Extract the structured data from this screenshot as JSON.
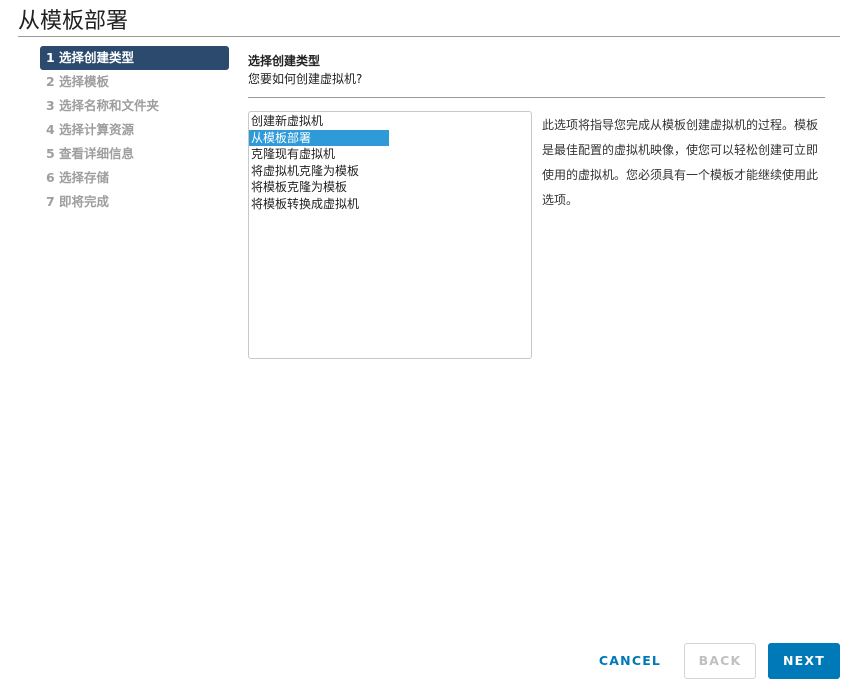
{
  "dialog": {
    "title": "从模板部署"
  },
  "steps": [
    {
      "label": "1 选择创建类型",
      "active": true
    },
    {
      "label": "2 选择模板",
      "active": false
    },
    {
      "label": "3 选择名称和文件夹",
      "active": false
    },
    {
      "label": "4 选择计算资源",
      "active": false
    },
    {
      "label": "5 查看详细信息",
      "active": false
    },
    {
      "label": "6 选择存储",
      "active": false
    },
    {
      "label": "7 即将完成",
      "active": false
    }
  ],
  "main": {
    "title": "选择创建类型",
    "subtitle": "您要如何创建虚拟机?",
    "creation_types": [
      "创建新虚拟机",
      "从模板部署",
      "克隆现有虚拟机",
      "将虚拟机克隆为模板",
      "将模板克隆为模板",
      "将模板转换成虚拟机"
    ],
    "selected_type": "从模板部署",
    "description": "此选项将指导您完成从模板创建虚拟机的过程。模板是最佳配置的虚拟机映像，使您可以轻松创建可立即使用的虚拟机。您必须具有一个模板才能继续使用此选项。"
  },
  "footer": {
    "cancel_label": "CANCEL",
    "back_label": "BACK",
    "next_label": "NEXT"
  },
  "colors": {
    "active_step_bg": "#2b4a6e",
    "selected_option_bg": "#2f9ad8",
    "primary_button": "#0079b8",
    "link_color": "#0079b8"
  }
}
